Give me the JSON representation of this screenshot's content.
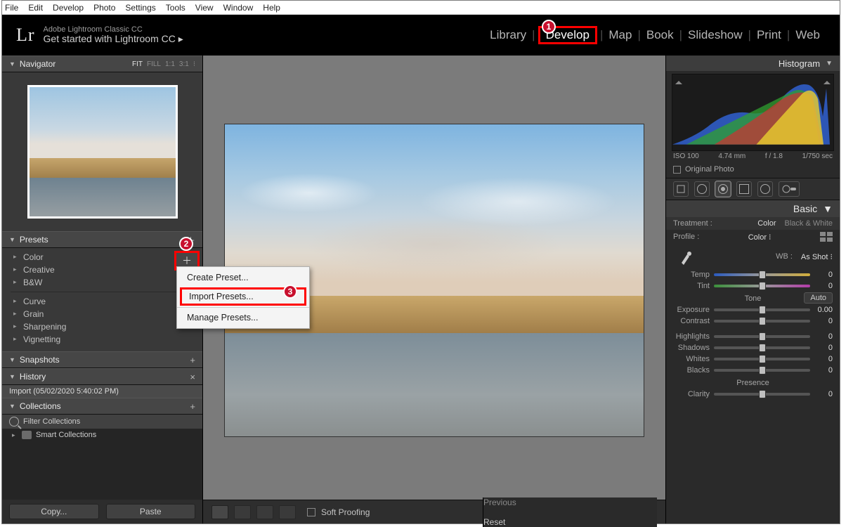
{
  "os_menu": [
    "File",
    "Edit",
    "Develop",
    "Photo",
    "Settings",
    "Tools",
    "View",
    "Window",
    "Help"
  ],
  "identity": {
    "logo": "Lr",
    "line1": "Adobe Lightroom Classic CC",
    "line2": "Get started with Lightroom CC  ▸"
  },
  "modules": [
    "Library",
    "Develop",
    "Map",
    "Book",
    "Slideshow",
    "Print",
    "Web"
  ],
  "modules_active": "Develop",
  "callouts": {
    "c1": "1",
    "c2": "2",
    "c3": "3"
  },
  "navigator": {
    "title": "Navigator",
    "fit": "FIT",
    "fill": "FILL",
    "r11": "1:1",
    "r31": "3:1",
    "arrow": "⁝"
  },
  "presets": {
    "title": "Presets",
    "add": "✚",
    "groups": [
      "Color",
      "Creative",
      "B&W"
    ],
    "groups2": [
      "Curve",
      "Grain",
      "Sharpening",
      "Vignetting"
    ]
  },
  "context_menu": {
    "create": "Create Preset...",
    "import": "Import Presets...",
    "manage": "Manage Presets..."
  },
  "snapshots": {
    "title": "Snapshots",
    "add": "+"
  },
  "history": {
    "title": "History",
    "close": "×",
    "entry": "Import (05/02/2020 5:40:02 PM)"
  },
  "collections": {
    "title": "Collections",
    "add": "+",
    "filter": "Filter Collections",
    "smart": "Smart Collections"
  },
  "copy": "Copy...",
  "paste": "Paste",
  "toolbar": {
    "soft": "Soft Proofing",
    "prev": "Previous",
    "reset": "Reset"
  },
  "right": {
    "histogram": "Histogram",
    "meta": {
      "iso": "ISO 100",
      "focal": "4.74 mm",
      "aperture": "f / 1.8",
      "shutter": "1/750 sec"
    },
    "original": "Original Photo",
    "basic": "Basic",
    "treatment": "Treatment :",
    "color": "Color",
    "bw": "Black & White",
    "profile": "Profile :",
    "profile_val": "Color  ⁝",
    "wb": "WB :",
    "wb_val": "As Shot ⁝",
    "sliders": {
      "temp": {
        "label": "Temp",
        "val": "0"
      },
      "tint": {
        "label": "Tint",
        "val": "0"
      },
      "exposure": {
        "label": "Exposure",
        "val": "0.00"
      },
      "contrast": {
        "label": "Contrast",
        "val": "0"
      },
      "highlights": {
        "label": "Highlights",
        "val": "0"
      },
      "shadows": {
        "label": "Shadows",
        "val": "0"
      },
      "whites": {
        "label": "Whites",
        "val": "0"
      },
      "blacks": {
        "label": "Blacks",
        "val": "0"
      },
      "clarity": {
        "label": "Clarity",
        "val": "0"
      }
    },
    "tone": "Tone",
    "auto": "Auto",
    "presence": "Presence"
  }
}
